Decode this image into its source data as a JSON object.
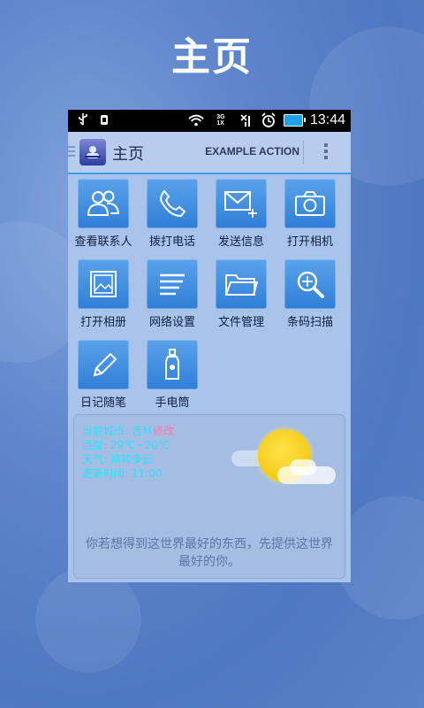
{
  "promo": {
    "title": "主页"
  },
  "status_bar": {
    "time": "13:44",
    "network_top": "3G",
    "network_bottom": "1X",
    "icons": [
      "usb-icon",
      "debug-icon",
      "wifi-icon",
      "signal-icon",
      "no-signal-icon",
      "alarm-icon",
      "battery-charging-icon"
    ]
  },
  "action_bar": {
    "title": "主页",
    "action_label": "EXAMPLE ACTION",
    "accent": "#3aa0ea"
  },
  "grid": {
    "items": [
      {
        "label": "查看联系人",
        "icon": "contacts-icon"
      },
      {
        "label": "拨打电话",
        "icon": "phone-icon"
      },
      {
        "label": "发送信息",
        "icon": "compose-message-icon"
      },
      {
        "label": "打开相机",
        "icon": "camera-icon"
      },
      {
        "label": "打开相册",
        "icon": "gallery-icon"
      },
      {
        "label": "网络设置",
        "icon": "network-settings-icon"
      },
      {
        "label": "文件管理",
        "icon": "folder-icon"
      },
      {
        "label": "条码扫描",
        "icon": "barcode-scan-icon"
      },
      {
        "label": "日记随笔",
        "icon": "pencil-icon"
      },
      {
        "label": "手电筒",
        "icon": "flashlight-icon"
      }
    ],
    "tile_color": "#3d8de0"
  },
  "weather": {
    "city_label": "当前城市:",
    "city": "吉林",
    "change": "修改",
    "temp": "温度: 29℃~20℃",
    "condition": "天气: 晴转多云",
    "updated": "更新时间: 11:00",
    "quote": "你若想得到这世界最好的东西，先提供这世界最好的你。"
  }
}
